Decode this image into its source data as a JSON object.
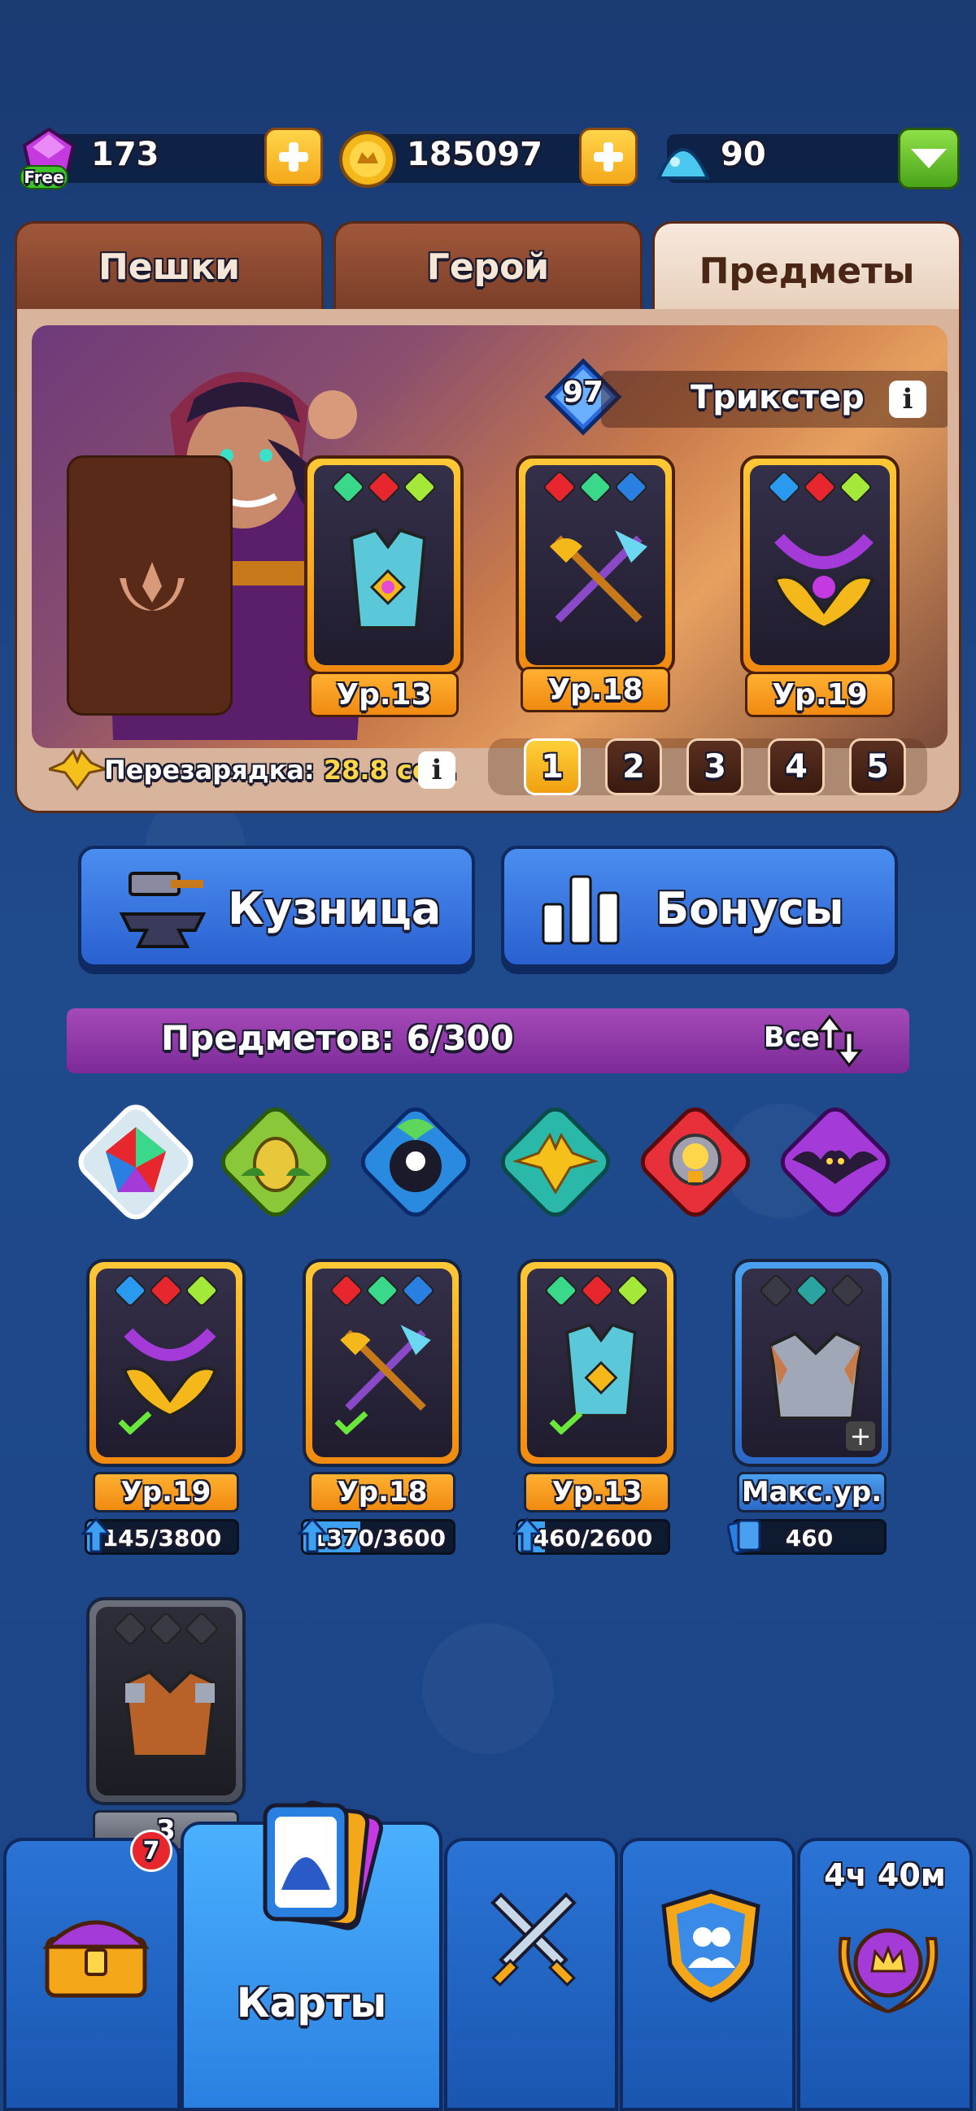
{
  "currencies": {
    "gems": "173",
    "gems_badge": "Free",
    "coins": "185097",
    "crystals": "90"
  },
  "tabs": [
    {
      "label": "Пешки",
      "active": false
    },
    {
      "label": "Герой",
      "active": false
    },
    {
      "label": "Предметы",
      "active": true
    }
  ],
  "hero": {
    "level": "97",
    "name": "Трикстер",
    "recharge_label": "Перезарядка:",
    "recharge_value": "28.8 сек.",
    "info_icon": "i",
    "equipped": [
      {
        "level_label": "Ур.13",
        "gems": [
          "#3ad88a",
          "#e8262e",
          "#a4e83a"
        ]
      },
      {
        "level_label": "Ур.18",
        "gems": [
          "#e8262e",
          "#3ad88a",
          "#2a80e0"
        ]
      },
      {
        "level_label": "Ур.19",
        "gems": [
          "#2a9af0",
          "#e8262e",
          "#a4e83a"
        ]
      }
    ],
    "slots": [
      "1",
      "2",
      "3",
      "4",
      "5"
    ],
    "active_slot": "1"
  },
  "actions": {
    "forge": "Кузница",
    "bonuses": "Бонусы"
  },
  "inventory": {
    "count_label": "Предметов: 6/300",
    "filter_label": "Все",
    "categories": [
      "all-icon",
      "flower-icon",
      "eight-ball-icon",
      "eagle-icon",
      "lightbulb-icon",
      "bat-icon"
    ],
    "items": [
      {
        "level_label": "Ур.19",
        "progress_text": "145/3800",
        "progress": 0.04,
        "gems": [
          "#2a9af0",
          "#e8262e",
          "#a4e83a"
        ],
        "style": "orange"
      },
      {
        "level_label": "Ур.18",
        "progress_text": "1370/3600",
        "progress": 0.38,
        "gems": [
          "#e8262e",
          "#3ad88a",
          "#2a80e0"
        ],
        "style": "orange"
      },
      {
        "level_label": "Ур.13",
        "progress_text": "460/2600",
        "progress": 0.18,
        "gems": [
          "#3ad88a",
          "#e8262e",
          "#a4e83a"
        ],
        "style": "orange"
      },
      {
        "level_label": "Макс.ур.",
        "progress_text": "460",
        "progress": 0,
        "gems": [
          "#3a3a44",
          "#2aa4a0",
          "#3a3a44"
        ],
        "style": "blue"
      },
      {
        "level_label": "",
        "progress_text": "",
        "progress": 0,
        "gems": [
          "#3a3a44",
          "#3a3a44",
          "#3a3a44"
        ],
        "style": "grey"
      }
    ],
    "partial_level_text": "3"
  },
  "bottom_nav": {
    "cards_label": "Карты",
    "chest_badge": "7",
    "timer": "4ч 40м"
  }
}
